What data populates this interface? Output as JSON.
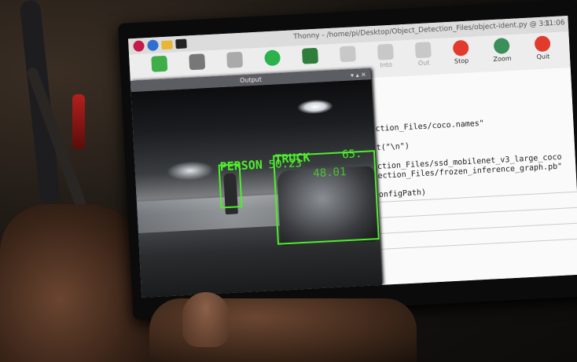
{
  "window": {
    "title": "Thonny - /home/pi/Desktop/Object_Detection_Files/object-ident.py @ 3:1",
    "clock": "11:06"
  },
  "toolbar": {
    "new": "",
    "load": "",
    "save": "",
    "run": "",
    "debug": "",
    "over": "",
    "into": "Into",
    "out": "Out",
    "stop": "Stop",
    "zoom": "Zoom",
    "quit": "Quit"
  },
  "editor": {
    "lines": [
      "ction_Files/coco.names\"",
      "t(\"\\n\")",
      "ction_Files/ssd_mobilenet_v3_large_coco",
      "ection_Files/frozen_inference_graph.pb\"",
      "onfigPath)"
    ]
  },
  "output_window": {
    "title": "Output",
    "detections": [
      {
        "label": "PERSON",
        "score": "50.23"
      },
      {
        "label": "TRUCK",
        "score": "65."
      },
      {
        "label": "",
        "score": "48.01"
      }
    ]
  },
  "colors": {
    "detection_box": "#4cef2a",
    "stop_button": "#e23b2e",
    "quit_button": "#e23b2e",
    "run_button": "#2bb24c"
  }
}
